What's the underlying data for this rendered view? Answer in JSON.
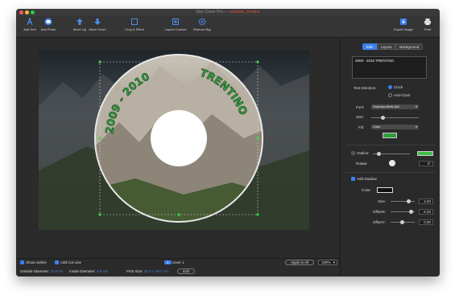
{
  "window": {
    "app_name": "Disc Cover Pro",
    "doc_name": "vacation_trentino"
  },
  "toolbar": {
    "add_text": "Add Text",
    "add_photo": "Add Photo",
    "move_up": "Move Up",
    "move_down": "Move Down",
    "crop_effect": "Crop & Effect",
    "layout_custom": "Layout Custom",
    "remove_bg": "Remove Bgr",
    "export_image": "Export Image",
    "print": "Print"
  },
  "disc": {
    "label_year": "2009 - 2010",
    "label_place": "TRENTINO"
  },
  "bottom": {
    "show_outline": "Show outline",
    "add_cut_line": "Add Cut Line",
    "layer_index": "1",
    "layer_name": "cover 1",
    "apply_to_all": "Apply to All",
    "zoom": "100%",
    "outside_diameter_label": "Outside Diameter:",
    "outside_diameter_value": "11.8 cm",
    "inside_diameter_label": "Inside Diameter:",
    "inside_diameter_value": "4.6 cm",
    "print_size_label": "Print Size:",
    "print_size_value": "21.0 × 29.7 cm",
    "edit_button": "Edit"
  },
  "inspector": {
    "tabs": [
      "Edit",
      "Layout",
      "Background"
    ],
    "text_content": "2009 - 2010     TRENTINO",
    "text_direction_label": "Text Direction:",
    "clock": "Clock",
    "anti_clock": "Anti-Clock",
    "font_label": "Font:",
    "font_value": "HiraKakuStdN-W8",
    "size_label": "Size:",
    "fill_label": "Fill:",
    "fill_value": "Color",
    "fill_color": "#2e9e3e",
    "outline_label": "Outline:",
    "outline_color": "#3fbf4a",
    "rotate_label": "Rotate:",
    "rotate_value": "0°",
    "add_shadow": "Add shadow",
    "color_label": "Color:",
    "size2_label": "Size:",
    "size2_value": "4.00",
    "offset_x_label": "OffsetX:",
    "offset_x_value": "6.00",
    "offset_y_label": "OffsetY:",
    "offset_y_value": "0.00"
  }
}
